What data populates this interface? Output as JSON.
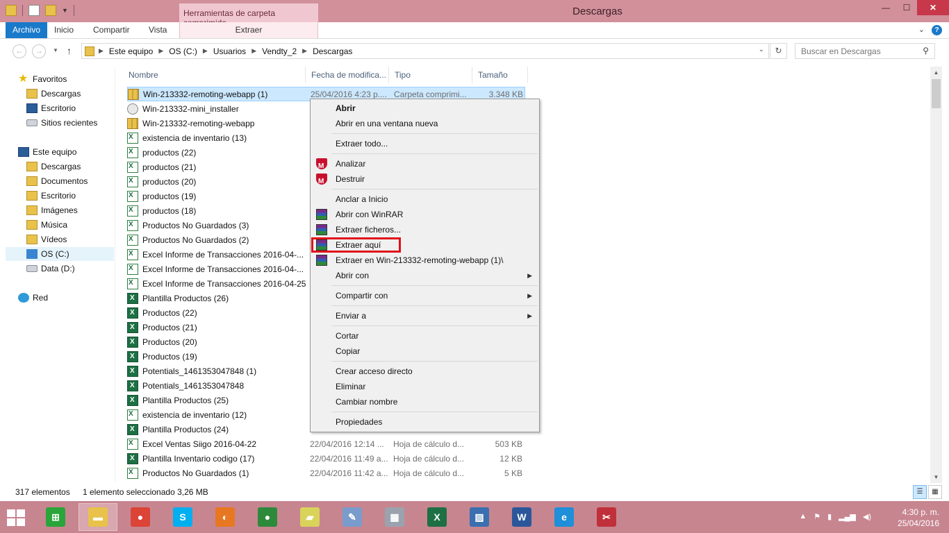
{
  "window": {
    "title": "Descargas",
    "context_tab_group": "Herramientas de carpeta comprimida",
    "caption": {
      "minimize": "—",
      "maximize": "☐",
      "close": "✕"
    }
  },
  "ribbon": {
    "tabs": [
      "Archivo",
      "Inicio",
      "Compartir",
      "Vista",
      "Extraer"
    ],
    "expand": "⌄",
    "help": "?"
  },
  "address": {
    "crumbs": [
      "Este equipo",
      "OS (C:)",
      "Usuarios",
      "Vendty_2",
      "Descargas"
    ],
    "search_placeholder": "Buscar en Descargas"
  },
  "nav": {
    "favorites": "Favoritos",
    "fav_items": [
      "Descargas",
      "Escritorio",
      "Sitios recientes"
    ],
    "this_pc": "Este equipo",
    "pc_items": [
      "Descargas",
      "Documentos",
      "Escritorio",
      "Imágenes",
      "Música",
      "Vídeos",
      "OS (C:)",
      "Data (D:)"
    ],
    "network": "Red"
  },
  "columns": {
    "name": "Nombre",
    "date": "Fecha de modifica...",
    "type": "Tipo",
    "size": "Tamaño"
  },
  "files": [
    {
      "name": "Win-213332-remoting-webapp (1)",
      "date": "25/04/2016 4:23 p....",
      "type": "Carpeta comprimi...",
      "size": "3.348 KB",
      "icon": "zip"
    },
    {
      "name": "Win-213332-mini_installer",
      "date": "",
      "type": "",
      "size": "",
      "icon": "exe"
    },
    {
      "name": "Win-213332-remoting-webapp",
      "date": "",
      "type": "",
      "size": "",
      "icon": "zip"
    },
    {
      "name": "existencia de inventario (13)",
      "date": "",
      "type": "",
      "size": "",
      "icon": "xls"
    },
    {
      "name": "productos (22)",
      "date": "",
      "type": "",
      "size": "",
      "icon": "xls"
    },
    {
      "name": "productos (21)",
      "date": "",
      "type": "",
      "size": "",
      "icon": "xls"
    },
    {
      "name": "productos (20)",
      "date": "",
      "type": "",
      "size": "",
      "icon": "xls"
    },
    {
      "name": "productos (19)",
      "date": "",
      "type": "",
      "size": "",
      "icon": "xls"
    },
    {
      "name": "productos (18)",
      "date": "",
      "type": "",
      "size": "",
      "icon": "xls"
    },
    {
      "name": "Productos No Guardados (3)",
      "date": "",
      "type": "",
      "size": "",
      "icon": "xls"
    },
    {
      "name": "Productos No Guardados (2)",
      "date": "",
      "type": "",
      "size": "",
      "icon": "xls"
    },
    {
      "name": "Excel Informe de Transacciones 2016-04-...",
      "date": "",
      "type": "",
      "size": "",
      "icon": "xls"
    },
    {
      "name": "Excel Informe de Transacciones 2016-04-...",
      "date": "",
      "type": "",
      "size": "",
      "icon": "xls"
    },
    {
      "name": "Excel Informe de Transacciones 2016-04-25",
      "date": "",
      "type": "",
      "size": "",
      "icon": "xls"
    },
    {
      "name": "Plantilla Productos (26)",
      "date": "",
      "type": "",
      "size": "",
      "icon": "xlsx"
    },
    {
      "name": "Productos (22)",
      "date": "",
      "type": "",
      "size": "",
      "icon": "xlsx"
    },
    {
      "name": "Productos (21)",
      "date": "",
      "type": "",
      "size": "",
      "icon": "xlsx"
    },
    {
      "name": "Productos (20)",
      "date": "",
      "type": "",
      "size": "",
      "icon": "xlsx"
    },
    {
      "name": "Productos (19)",
      "date": "",
      "type": "",
      "size": "",
      "icon": "xlsx"
    },
    {
      "name": "Potentials_1461353047848 (1)",
      "date": "",
      "type": "",
      "size": "",
      "icon": "xlsx"
    },
    {
      "name": "Potentials_1461353047848",
      "date": "",
      "type": "",
      "size": "",
      "icon": "xlsx"
    },
    {
      "name": "Plantilla Productos (25)",
      "date": "",
      "type": "",
      "size": "",
      "icon": "xlsx"
    },
    {
      "name": "existencia de inventario (12)",
      "date": "",
      "type": "",
      "size": "",
      "icon": "xls"
    },
    {
      "name": "Plantilla Productos (24)",
      "date": "",
      "type": "",
      "size": "",
      "icon": "xlsx"
    },
    {
      "name": "Excel Ventas Siigo 2016-04-22",
      "date": "22/04/2016 12:14 ...",
      "type": "Hoja de cálculo d...",
      "size": "503 KB",
      "icon": "xls"
    },
    {
      "name": "Plantilla Inventario codigo (17)",
      "date": "22/04/2016 11:49 a...",
      "type": "Hoja de cálculo d...",
      "size": "12 KB",
      "icon": "xlsx"
    },
    {
      "name": "Productos No Guardados (1)",
      "date": "22/04/2016 11:42 a...",
      "type": "Hoja de cálculo d...",
      "size": "5 KB",
      "icon": "xls"
    }
  ],
  "context_menu": {
    "items": [
      {
        "label": "Abrir",
        "bold": true,
        "icon": "",
        "sub": false
      },
      {
        "label": "Abrir en una ventana nueva",
        "icon": "",
        "sub": false
      },
      {
        "sep": true
      },
      {
        "label": "Extraer todo...",
        "icon": "",
        "sub": false
      },
      {
        "sep": true
      },
      {
        "label": "Analizar",
        "icon": "mcafee",
        "sub": false
      },
      {
        "label": "Destruir",
        "icon": "mcafee",
        "sub": false
      },
      {
        "sep": true
      },
      {
        "label": "Anclar a Inicio",
        "icon": "",
        "sub": false
      },
      {
        "label": "Abrir con WinRAR",
        "icon": "rar",
        "sub": false
      },
      {
        "label": "Extraer ficheros...",
        "icon": "rar",
        "sub": false
      },
      {
        "label": "Extraer aquí",
        "icon": "rar",
        "sub": false,
        "highlight": true
      },
      {
        "label": "Extraer en Win-213332-remoting-webapp (1)\\",
        "icon": "rar",
        "sub": false
      },
      {
        "label": "Abrir con",
        "icon": "",
        "sub": true
      },
      {
        "sep": true
      },
      {
        "label": "Compartir con",
        "icon": "",
        "sub": true
      },
      {
        "sep": true
      },
      {
        "label": "Enviar a",
        "icon": "",
        "sub": true
      },
      {
        "sep": true
      },
      {
        "label": "Cortar",
        "icon": "",
        "sub": false
      },
      {
        "label": "Copiar",
        "icon": "",
        "sub": false
      },
      {
        "sep": true
      },
      {
        "label": "Crear acceso directo",
        "icon": "",
        "sub": false
      },
      {
        "label": "Eliminar",
        "icon": "",
        "sub": false
      },
      {
        "label": "Cambiar nombre",
        "icon": "",
        "sub": false
      },
      {
        "sep": true
      },
      {
        "label": "Propiedades",
        "icon": "",
        "sub": false
      }
    ]
  },
  "status": {
    "count": "317 elementos",
    "selected": "1 elemento seleccionado  3,26 MB"
  },
  "taskbar": {
    "apps": [
      {
        "name": "store",
        "glyph": "⊞",
        "color": "#2aa53a"
      },
      {
        "name": "file-explorer",
        "glyph": "▬",
        "color": "#e8c24a",
        "active": true
      },
      {
        "name": "chrome",
        "glyph": "●",
        "color": "#db4437"
      },
      {
        "name": "skype",
        "glyph": "S",
        "color": "#00aff0"
      },
      {
        "name": "app-orange",
        "glyph": "◐",
        "color": "#e87722"
      },
      {
        "name": "maps-pin",
        "glyph": "●",
        "color": "#2d8a3a"
      },
      {
        "name": "sticky-notes",
        "glyph": "▰",
        "color": "#d9d35a"
      },
      {
        "name": "paint",
        "glyph": "✎",
        "color": "#7a9ccc"
      },
      {
        "name": "calculator",
        "glyph": "▦",
        "color": "#9aa3ad"
      },
      {
        "name": "excel",
        "glyph": "X",
        "color": "#1d7043"
      },
      {
        "name": "photos",
        "glyph": "▨",
        "color": "#3a6fb0"
      },
      {
        "name": "word",
        "glyph": "W",
        "color": "#2b579a"
      },
      {
        "name": "internet-explorer",
        "glyph": "e",
        "color": "#1e8fd8"
      },
      {
        "name": "snipping-tool",
        "glyph": "✂",
        "color": "#c0303a"
      }
    ],
    "time": "4:30 p. m.",
    "date": "25/04/2016"
  }
}
